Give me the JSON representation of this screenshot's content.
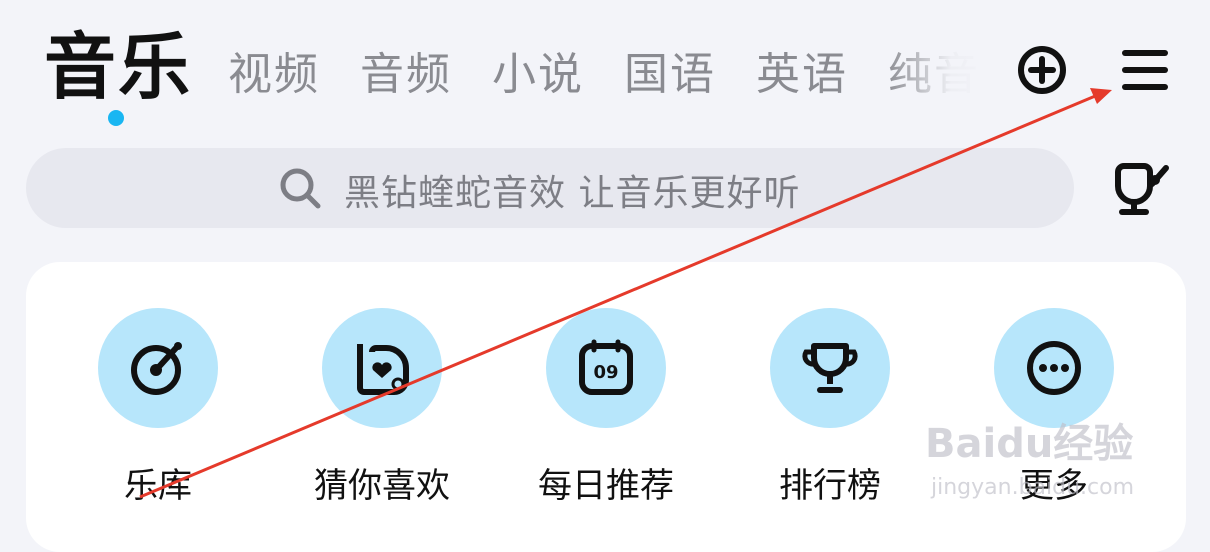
{
  "header": {
    "active_tab": "音乐",
    "tabs": [
      "视频",
      "音频",
      "小说",
      "国语",
      "英语",
      "纯音"
    ],
    "add_icon": "plus-circle-icon",
    "menu_icon": "hamburger-menu-icon"
  },
  "search": {
    "placeholder": "黑钻蝰蛇音效 让音乐更好听",
    "icon": "search-icon",
    "side_icon": "microphone-icon"
  },
  "shortcuts": [
    {
      "label": "乐库",
      "icon": "music-library-icon"
    },
    {
      "label": "猜你喜欢",
      "icon": "heart-playlist-icon"
    },
    {
      "label": "每日推荐",
      "icon": "calendar-icon",
      "badge": "09"
    },
    {
      "label": "排行榜",
      "icon": "trophy-icon"
    },
    {
      "label": "更多",
      "icon": "more-icon"
    }
  ],
  "watermark": {
    "logo": "Baidu经验",
    "url": "jingyan.baidu.com"
  },
  "colors": {
    "background": "#f3f4f9",
    "accent_dot": "#19b6f2",
    "icon_circle": "#b7e6fb",
    "annotation_arrow": "#e53a2b"
  }
}
